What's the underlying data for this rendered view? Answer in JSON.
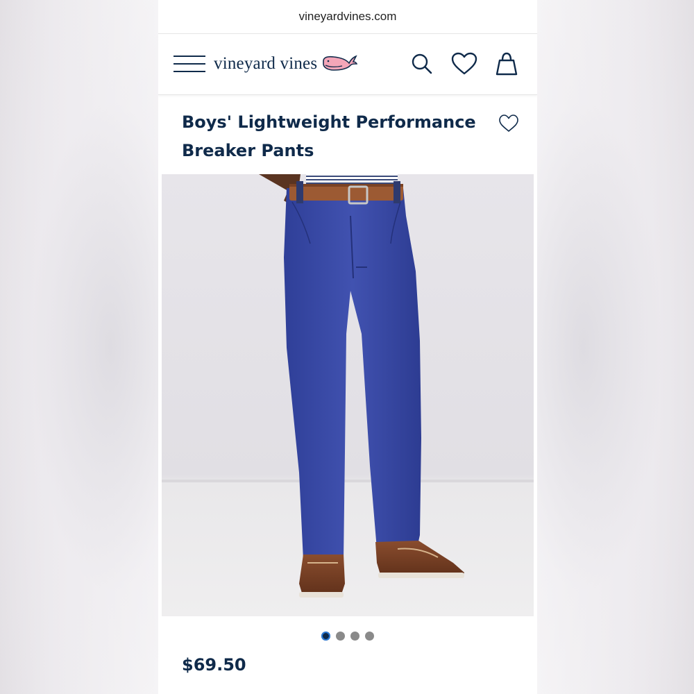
{
  "browser": {
    "url": "vineyardvines.com"
  },
  "header": {
    "brand": "vineyard vines",
    "menu_icon": "hamburger-menu-icon",
    "logo_icon": "whale-logo-icon",
    "search_icon": "search-icon",
    "wishlist_icon": "heart-icon",
    "bag_icon": "shopping-bag-icon"
  },
  "product": {
    "title_line1": "Boys' Lightweight Performance",
    "title_line2": "Breaker Pants",
    "favorite_icon": "heart-outline-icon",
    "price": "$69.50",
    "image_count": 4,
    "active_image": 1
  },
  "colors": {
    "navy": "#0f2a4a",
    "whale_pink": "#f4a6b8",
    "pants_blue": "#3c4ea8",
    "dot_inactive": "#8a8a8a"
  }
}
